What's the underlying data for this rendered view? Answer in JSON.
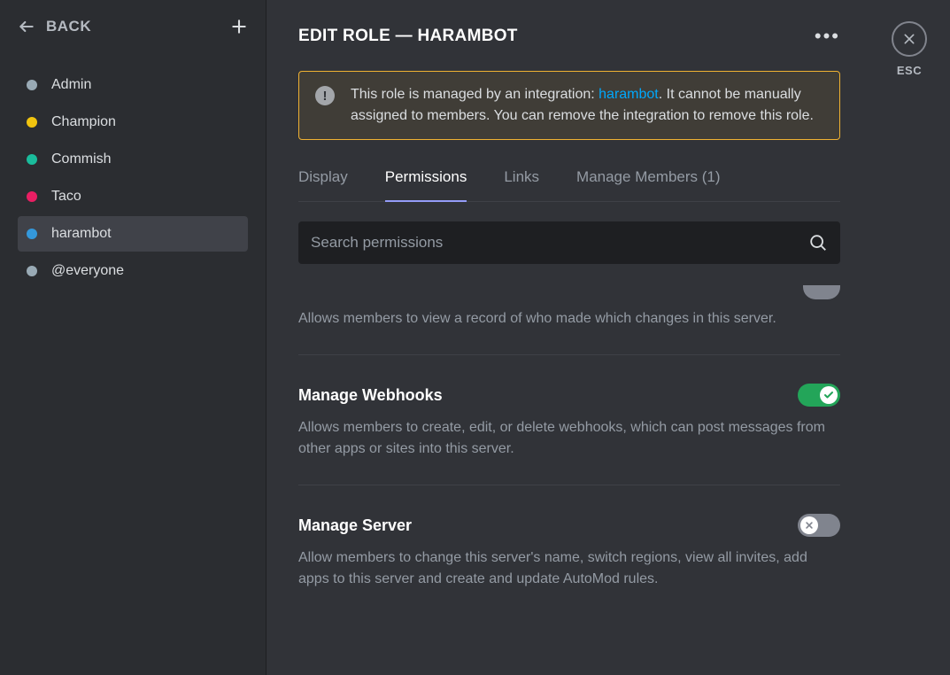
{
  "sidebar": {
    "back_label": "BACK",
    "roles": [
      {
        "name": "Admin",
        "color": "#99aab5"
      },
      {
        "name": "Champion",
        "color": "#f1c40f"
      },
      {
        "name": "Commish",
        "color": "#1abc9c"
      },
      {
        "name": "Taco",
        "color": "#e91e63"
      },
      {
        "name": "harambot",
        "color": "#3498db"
      },
      {
        "name": "@everyone",
        "color": "#99aab5"
      }
    ]
  },
  "header": {
    "title": "EDIT ROLE — HARAMBOT"
  },
  "warning": {
    "prefix": "This role is managed by an integration: ",
    "link": "harambot",
    "suffix": ". It cannot be manually assigned to members. You can remove the integration to remove this role."
  },
  "tabs": {
    "display": "Display",
    "permissions": "Permissions",
    "links": "Links",
    "manage_members": "Manage Members (1)"
  },
  "search": {
    "placeholder": "Search permissions"
  },
  "partial_desc": "Allows members to view a record of who made which changes in this server.",
  "permissions": [
    {
      "title": "Manage Webhooks",
      "desc": "Allows members to create, edit, or delete webhooks, which can post messages from other apps or sites into this server.",
      "enabled": true
    },
    {
      "title": "Manage Server",
      "desc": "Allow members to change this server's name, switch regions, view all invites, add apps to this server and create and update AutoMod rules.",
      "enabled": false
    }
  ],
  "close": {
    "esc": "ESC"
  }
}
